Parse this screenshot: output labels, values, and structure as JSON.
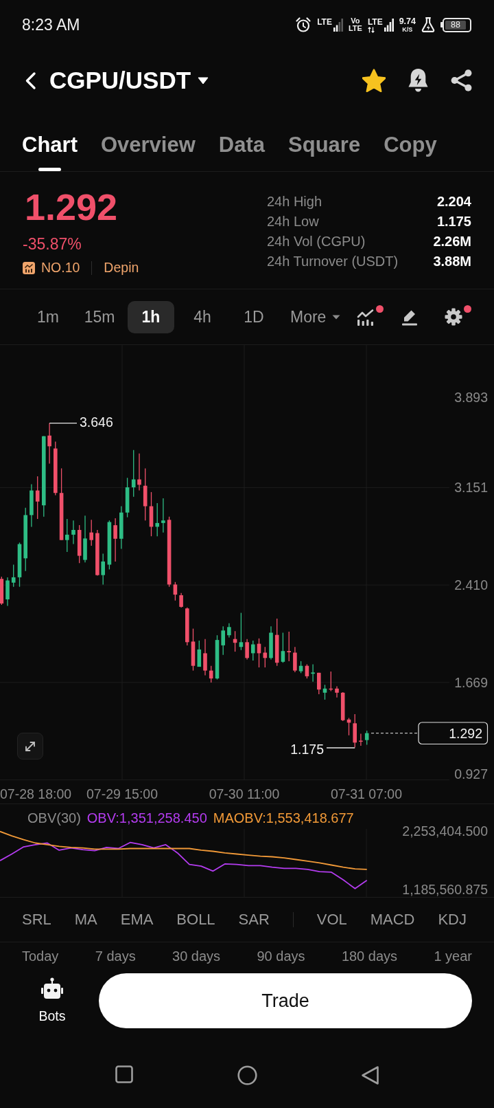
{
  "status_bar": {
    "time": "8:23 AM",
    "sim_1_network": "LTE",
    "volte": [
      "Vo",
      "LTE"
    ],
    "sim_2_network": "LTE",
    "speed": "9.74",
    "speed_unit": "K/S",
    "battery": "88"
  },
  "header": {
    "pair": "CGPU/USDT",
    "favorite": true
  },
  "tabs": [
    {
      "label": "Chart",
      "selected": true
    },
    {
      "label": "Overview",
      "selected": false
    },
    {
      "label": "Data",
      "selected": false
    },
    {
      "label": "Square",
      "selected": false
    },
    {
      "label": "Copy",
      "selected": false
    }
  ],
  "ticker": {
    "price": "1.292",
    "change": "-35.87%",
    "rank": "NO.10",
    "sector": "Depin",
    "stats": [
      {
        "label": "24h High",
        "value": "2.204"
      },
      {
        "label": "24h Low",
        "value": "1.175"
      },
      {
        "label": "24h Vol (CGPU)",
        "value": "2.26M"
      },
      {
        "label": "24h Turnover (USDT)",
        "value": "3.88M"
      }
    ]
  },
  "intervals": [
    {
      "label": "1m",
      "selected": false
    },
    {
      "label": "15m",
      "selected": false
    },
    {
      "label": "1h",
      "selected": true
    },
    {
      "label": "4h",
      "selected": false
    },
    {
      "label": "1D",
      "selected": false
    }
  ],
  "more": "More",
  "tools": [
    {
      "kind": "indicators",
      "badge": true
    },
    {
      "kind": "draw",
      "badge": false
    },
    {
      "kind": "settings",
      "badge": true
    }
  ],
  "chart": {
    "price_axis": [
      "3.893",
      "3.151",
      "2.410",
      "1.669",
      "0.927"
    ],
    "time_axis": [
      "07-28 18:00",
      "07-29 15:00",
      "07-30 11:00",
      "07-31 07:00"
    ],
    "high_label": "3.646",
    "low_label": "1.175",
    "last_price": "1.292"
  },
  "obv": {
    "chart_data": {
      "type": "line",
      "title": "OBV(30)",
      "ylim": [
        1185560.875,
        2253404.5
      ],
      "yticks": [
        {
          "value": 2253404.5,
          "label": "2,253,404.500"
        },
        {
          "value": 1185560.875,
          "label": "1,185,560.875"
        }
      ],
      "series": [
        {
          "name": "OBV:1,351,258.450",
          "color": "#b43cf0",
          "values": [
            1710000,
            1830000,
            1960000,
            2000000,
            2030000,
            1900000,
            1940000,
            1910000,
            1890000,
            1950000,
            1930000,
            2040000,
            2000000,
            1940000,
            2000000,
            1850000,
            1640000,
            1610000,
            1520000,
            1650000,
            1640000,
            1620000,
            1620000,
            1590000,
            1570000,
            1570000,
            1550000,
            1510000,
            1500000,
            1360000,
            1200000,
            1350000
          ]
        },
        {
          "name": "MAOBV:1,553,418.677",
          "color": "#f29a38",
          "values": [
            2240000,
            2160000,
            2090000,
            2030000,
            2000000,
            1970000,
            1950000,
            1940000,
            1920000,
            1920000,
            1920000,
            1930000,
            1930000,
            1930000,
            1930000,
            1930000,
            1930000,
            1900000,
            1880000,
            1850000,
            1830000,
            1810000,
            1790000,
            1780000,
            1760000,
            1730000,
            1700000,
            1670000,
            1630000,
            1590000,
            1560000,
            1550000
          ]
        }
      ]
    }
  },
  "indicators": {
    "main": [
      "SRL",
      "MA",
      "EMA",
      "BOLL",
      "SAR"
    ],
    "sub": [
      "VOL",
      "MACD",
      "KDJ"
    ]
  },
  "periods": [
    "Today",
    "7 days",
    "30 days",
    "90 days",
    "180 days",
    "1 year"
  ],
  "bottom_bar": {
    "bots": "Bots",
    "trade": "Trade"
  }
}
